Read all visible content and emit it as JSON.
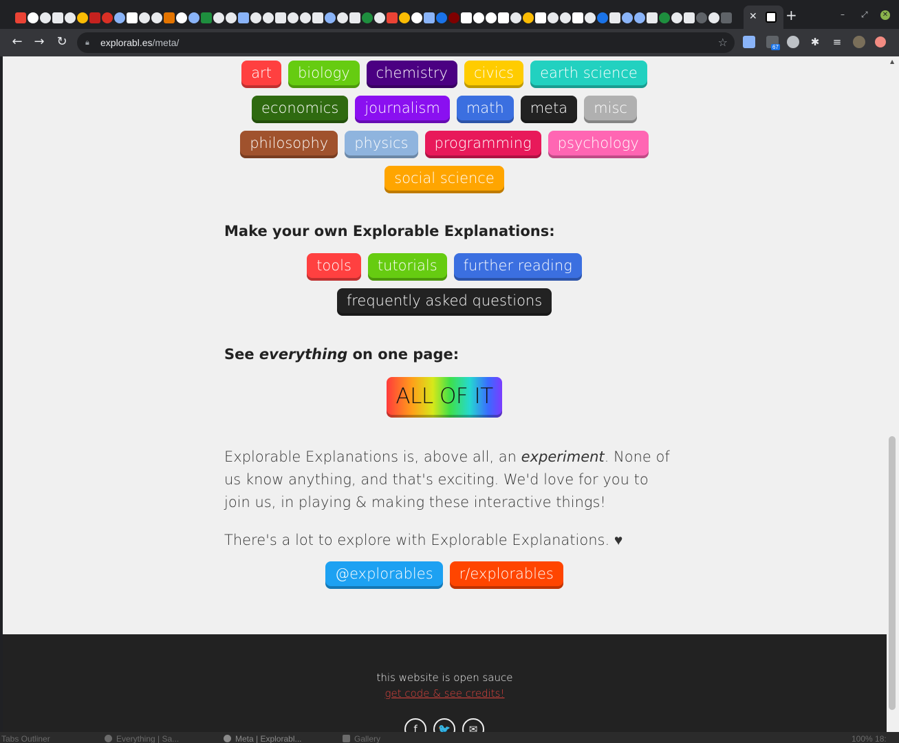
{
  "browser": {
    "url_host": "explorabl.es",
    "url_path": "/meta/",
    "extension_badge": "67"
  },
  "tags": {
    "row1": [
      {
        "label": "art",
        "color": "#ff4040"
      },
      {
        "label": "biology",
        "color": "#66cc11"
      },
      {
        "label": "chemistry",
        "color": "#4b0082"
      },
      {
        "label": "civics",
        "color": "#ffcc00"
      },
      {
        "label": "earth science",
        "color": "#22d1c0"
      }
    ],
    "row2": [
      {
        "label": "economics",
        "color": "#2f6a10"
      },
      {
        "label": "journalism",
        "color": "#8a10f0"
      },
      {
        "label": "math",
        "color": "#3b6fe0"
      },
      {
        "label": "meta",
        "color": "#222222"
      },
      {
        "label": "misc",
        "color": "#b0b0b0"
      }
    ],
    "row3": [
      {
        "label": "philosophy",
        "color": "#a0522d"
      },
      {
        "label": "physics",
        "color": "#8fb4de"
      },
      {
        "label": "programming",
        "color": "#e8195a"
      },
      {
        "label": "psychology",
        "color": "#ff66b3"
      }
    ],
    "row4": [
      {
        "label": "social science",
        "color": "#ffa500"
      }
    ]
  },
  "make": {
    "heading": "Make your own Explorable Explanations:",
    "buttons": [
      {
        "label": "tools",
        "color": "#ff4040"
      },
      {
        "label": "tutorials",
        "color": "#66cc11"
      },
      {
        "label": "further reading",
        "color": "#3b6fe0"
      }
    ],
    "faq": {
      "label": "frequently asked questions",
      "color": "#222222"
    }
  },
  "everything": {
    "heading_pre": "See ",
    "heading_em": "everything",
    "heading_post": " on one page:",
    "button": "ALL OF IT"
  },
  "about": {
    "p1_pre": "Explorable Explanations is, above all, an ",
    "p1_em": "experiment",
    "p1_post": ". None of us know anything, and that's exciting. We'd love for you to join us, in playing & making these interactive things!",
    "p2": "There's a lot to explore with Explorable Explanations. ♥"
  },
  "social_buttons": [
    {
      "label": "@explorables",
      "color": "#1da1f2"
    },
    {
      "label": "r/explorables",
      "color": "#ff4500"
    }
  ],
  "footer": {
    "text": "this website is open sauce",
    "link": "get code & see credits!",
    "icons": [
      {
        "name": "facebook-icon",
        "glyph": "f"
      },
      {
        "name": "twitter-icon",
        "glyph": "🐦"
      },
      {
        "name": "email-icon",
        "glyph": "✉"
      }
    ]
  },
  "taskbar": {
    "items": [
      "Tabs Outliner",
      "Everything | Sa...",
      "Meta | Explorabl...",
      "Gallery"
    ],
    "clock": "100%  18:"
  }
}
